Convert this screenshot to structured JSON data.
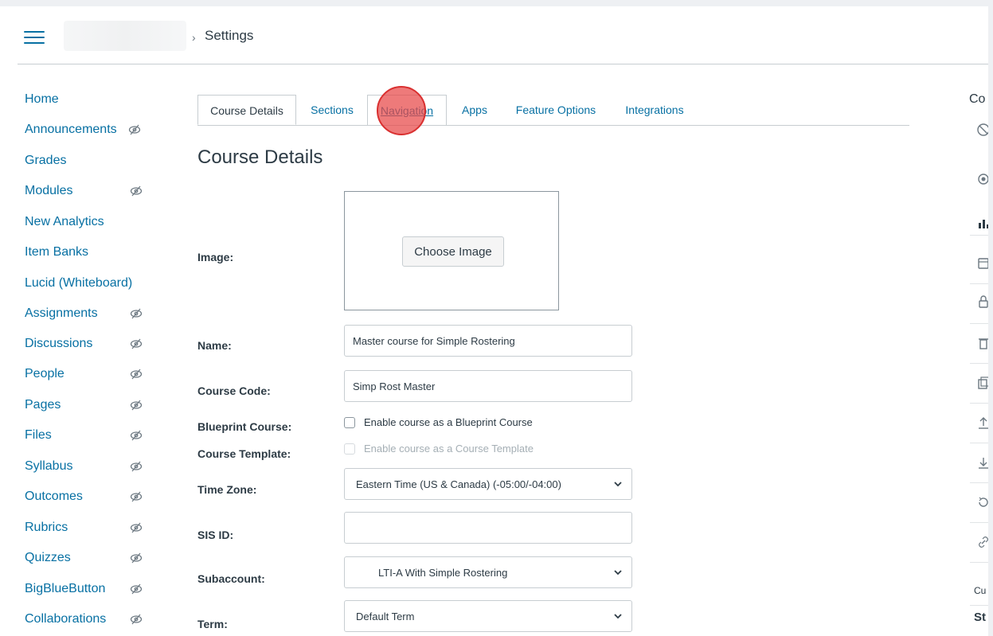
{
  "header": {
    "breadcrumb_separator": "›",
    "breadcrumb_current": "Settings"
  },
  "course_nav": {
    "items": [
      {
        "label": "Home",
        "hidden": false
      },
      {
        "label": "Announcements",
        "hidden": true
      },
      {
        "label": "Grades",
        "hidden": false
      },
      {
        "label": "Modules",
        "hidden": true
      },
      {
        "label": "New Analytics",
        "hidden": false
      },
      {
        "label": "Item Banks",
        "hidden": false
      },
      {
        "label": "Lucid (Whiteboard)",
        "hidden": false
      },
      {
        "label": "Assignments",
        "hidden": true
      },
      {
        "label": "Discussions",
        "hidden": true
      },
      {
        "label": "People",
        "hidden": true
      },
      {
        "label": "Pages",
        "hidden": true
      },
      {
        "label": "Files",
        "hidden": true
      },
      {
        "label": "Syllabus",
        "hidden": true
      },
      {
        "label": "Outcomes",
        "hidden": true
      },
      {
        "label": "Rubrics",
        "hidden": true
      },
      {
        "label": "Quizzes",
        "hidden": true
      },
      {
        "label": "BigBlueButton",
        "hidden": true
      },
      {
        "label": "Collaborations",
        "hidden": true
      }
    ]
  },
  "tabs": [
    {
      "label": "Course Details",
      "active": true
    },
    {
      "label": "Sections",
      "active": false
    },
    {
      "label": "Navigation",
      "active": false
    },
    {
      "label": "Apps",
      "active": false
    },
    {
      "label": "Feature Options",
      "active": false
    },
    {
      "label": "Integrations",
      "active": false
    }
  ],
  "main": {
    "heading": "Course Details",
    "image_label": "Image:",
    "choose_image_button": "Choose Image",
    "name_label": "Name:",
    "name_value": "Master course for Simple Rostering",
    "course_code_label": "Course Code:",
    "course_code_value": "Simp Rost Master",
    "blueprint_label": "Blueprint Course:",
    "blueprint_checkbox": "Enable course as a Blueprint Course",
    "template_label": "Course Template:",
    "template_checkbox": "Enable course as a Course Template",
    "timezone_label": "Time Zone:",
    "timezone_value": "Eastern Time (US & Canada) (-05:00/-04:00)",
    "sis_label": "SIS ID:",
    "sis_value": "",
    "subaccount_label": "Subaccount:",
    "subaccount_value": "LTI-A With Simple Rostering",
    "term_label": "Term:",
    "term_value": "Default Term"
  },
  "right_panel": {
    "title_fragment": "Co",
    "text_fragment_1": "Cu",
    "text_fragment_2": "St"
  },
  "colors": {
    "link": "#0770a3",
    "text": "#2d3b45",
    "border": "#c7cdd1",
    "click_marker": "#e84646"
  }
}
